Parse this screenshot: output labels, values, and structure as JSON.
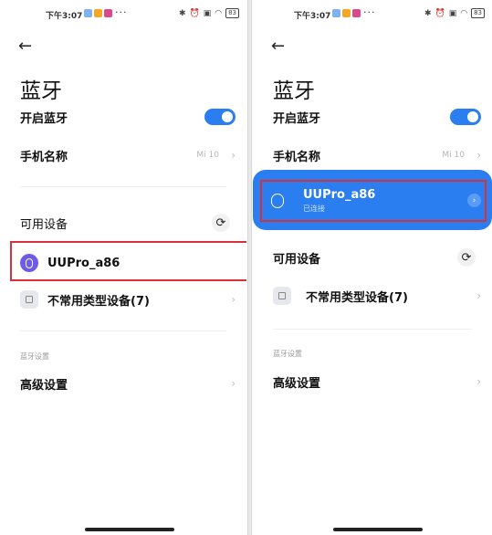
{
  "left": {
    "status": {
      "time": "下午3:07",
      "more": "···",
      "battery": "83"
    },
    "title": "蓝牙",
    "bluetooth_on_label": "开启蓝牙",
    "bluetooth_on": true,
    "device_name_label": "手机名称",
    "device_name_value": "Mi 10",
    "available_label": "可用设备",
    "device_1": "UUPro_a86",
    "device_2": "不常用类型设备(7)",
    "section_label": "蓝牙设置",
    "advanced_label": "高级设置"
  },
  "right": {
    "status": {
      "time": "下午3:07",
      "more": "···",
      "battery": "83"
    },
    "title": "蓝牙",
    "bluetooth_on_label": "开启蓝牙",
    "bluetooth_on": true,
    "device_name_label": "手机名称",
    "device_name_value": "Mi 10",
    "connected_device": "UUPro_a86",
    "connected_status": "已连接",
    "available_label": "可用设备",
    "device_2": "不常用类型设备(7)",
    "section_label": "蓝牙设置",
    "advanced_label": "高级设置"
  },
  "icons": {
    "back": "←",
    "chevron": "›",
    "refresh": "⟳"
  },
  "colors": {
    "accent": "#2b7ef0",
    "highlight_border": "#d8313a",
    "device_icon": "#6f5ce6"
  }
}
